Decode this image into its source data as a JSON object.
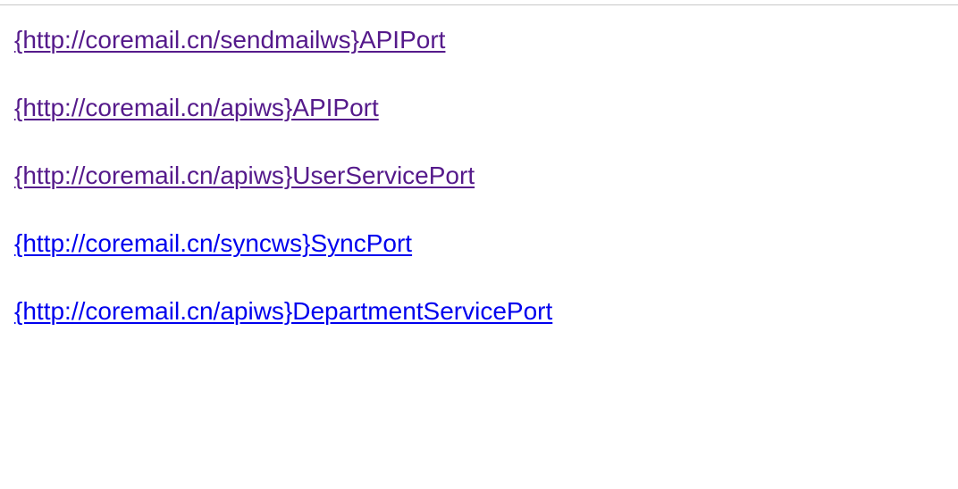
{
  "links": [
    {
      "text": "{http://coremail.cn/sendmailws}APIPort",
      "visited": true
    },
    {
      "text": "{http://coremail.cn/apiws}APIPort",
      "visited": true
    },
    {
      "text": "{http://coremail.cn/apiws}UserServicePort",
      "visited": true
    },
    {
      "text": "{http://coremail.cn/syncws}SyncPort",
      "visited": false
    },
    {
      "text": "{http://coremail.cn/apiws}DepartmentServicePort",
      "visited": false
    }
  ],
  "colors": {
    "visited_link": "#551a8b",
    "unvisited_link": "#0000ee",
    "divider": "#c8c8c8",
    "background": "#ffffff"
  }
}
